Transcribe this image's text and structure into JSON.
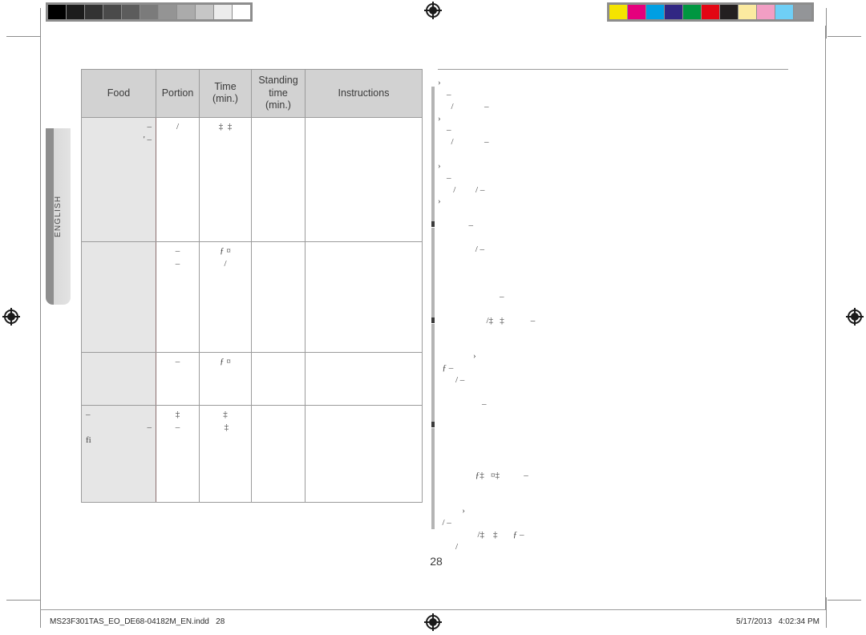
{
  "document": {
    "page_number": "28",
    "side_tab_label": "ENGLISH"
  },
  "calibration": {
    "gray_strip": {
      "name": "grayscale-calibration-strip",
      "swatches": [
        "#000000",
        "#1c1c1c",
        "#333333",
        "#4a4a4a",
        "#5c5c5c",
        "#7b7b7b",
        "#949494",
        "#ababab",
        "#c6c6c6",
        "#ececec",
        "#ffffff"
      ]
    },
    "color_strip": {
      "name": "color-calibration-strip",
      "swatches": [
        "#f5e400",
        "#e5007d",
        "#009fe3",
        "#312783",
        "#009640",
        "#e30613",
        "#231f20",
        "#fbeaa0",
        "#f29ec4",
        "#6fcff6",
        "#939598"
      ]
    }
  },
  "table": {
    "headers": [
      "Food",
      "Portion",
      "Time",
      "(min.)",
      "Standing",
      "time",
      "(min.)",
      "Instructions"
    ],
    "columns": [
      {
        "key": "food",
        "label": "Food"
      },
      {
        "key": "portion",
        "label": "Portion"
      },
      {
        "key": "time",
        "label": "Time",
        "sub": "(min.)"
      },
      {
        "key": "standing",
        "label": "Standing",
        "sub": "time",
        "sub2": "(min.)"
      },
      {
        "key": "instructions",
        "label": "Instructions"
      }
    ],
    "rows": [
      {
        "food": [
          "",
          "–",
          "' –"
        ],
        "portion": [
          "",
          "",
          "/"
        ],
        "time": [
          "‡  ‡",
          "",
          ""
        ],
        "standing": [
          ""
        ],
        "instructions": [
          ""
        ]
      },
      {
        "food": [
          ""
        ],
        "portion": [
          "–",
          "",
          "–"
        ],
        "time": [
          "ƒ ¤",
          "",
          "/"
        ],
        "standing": [
          ""
        ],
        "instructions": [
          ""
        ]
      },
      {
        "food": [
          ""
        ],
        "portion": [
          "–"
        ],
        "time": [
          "ƒ ¤"
        ],
        "standing": [
          ""
        ],
        "instructions": [
          ""
        ]
      },
      {
        "food": [
          "",
          "",
          "–",
          "      –",
          "fi"
        ],
        "portion": [
          "",
          "",
          "",
          "‡",
          "–"
        ],
        "time": [
          "‡",
          " ‡",
          "",
          "",
          ""
        ],
        "standing": [
          ""
        ],
        "instructions": [
          ""
        ]
      }
    ]
  },
  "right_column": {
    "lines": [
      "›",
      "    –",
      "      /              –",
      "›",
      "    –",
      "      /              –",
      "",
      "›",
      "    –",
      "       /         / –",
      "›",
      "",
      "              –",
      "",
      "                 / –",
      "",
      "",
      "",
      "                            –",
      "",
      "                      /‡   ‡            –",
      "",
      "",
      "                ›",
      "  ƒ –",
      "        / –",
      "",
      "                    –",
      "",
      "",
      "",
      "",
      "",
      "                 ƒ‡   ¤‡           –",
      "",
      "",
      "           ›",
      "  / –",
      "                  /‡    ‡       ƒ –",
      "        /"
    ]
  },
  "footer": {
    "left_text": "MS23F301TAS_EO_DE68-04182M_EN.indd   28",
    "right_text": "5/17/2013   4:02:34 PM"
  },
  "marks": {
    "registration_top": "registration-target",
    "registration_bottom": "registration-target",
    "registration_left": "registration-target",
    "registration_right": "registration-target"
  }
}
